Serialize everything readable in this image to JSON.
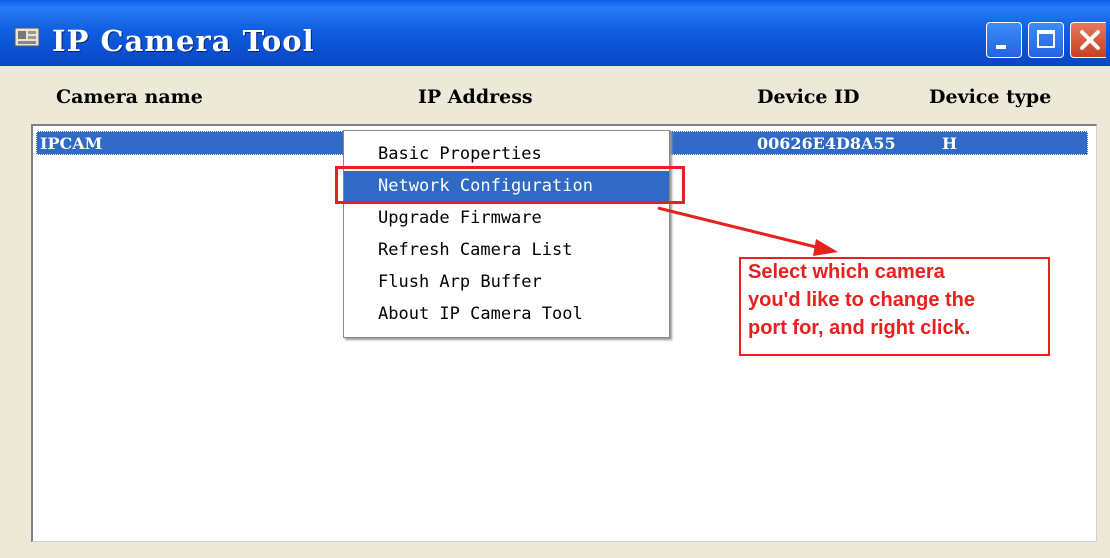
{
  "window": {
    "title": "IP Camera Tool",
    "icon": "app-icon",
    "controls": [
      "minimize-icon",
      "maximize-icon",
      "close-icon"
    ]
  },
  "columns": {
    "name": "Camera name",
    "ip": "IP Address",
    "device_id": "Device ID",
    "device_type": "Device type"
  },
  "cameras": [
    {
      "name": "IPCAM",
      "ip": "",
      "device_id": "00626E4D8A55",
      "device_type": "H"
    }
  ],
  "context_menu": {
    "items": [
      {
        "label": "Basic Properties",
        "selected": false
      },
      {
        "label": "Network Configuration",
        "selected": true
      },
      {
        "label": "Upgrade Firmware",
        "selected": false
      },
      {
        "label": "Refresh Camera List",
        "selected": false
      },
      {
        "label": "Flush Arp Buffer",
        "selected": false
      },
      {
        "label": "About IP Camera Tool",
        "selected": false
      }
    ]
  },
  "annotation": {
    "lines": [
      "Select which camera",
      "you'd like to change the",
      "port for, and right click."
    ],
    "color": "#e8201f"
  },
  "colors": {
    "titlebar": "#0a5fe6",
    "selection": "#316ac5",
    "window_bg": "#ece9d8"
  }
}
